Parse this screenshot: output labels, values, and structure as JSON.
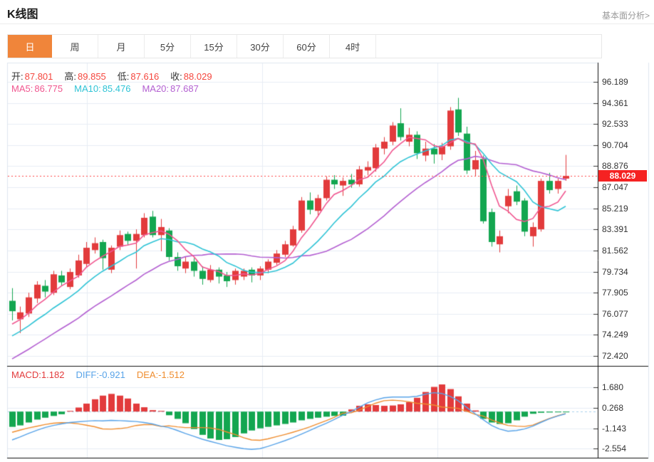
{
  "header": {
    "title": "K线图",
    "link": "基本面分析>"
  },
  "tabs": {
    "items": [
      "日",
      "周",
      "月",
      "5分",
      "15分",
      "30分",
      "60分",
      "4时"
    ],
    "active_index": 0
  },
  "ohlc": {
    "o_label": "开:",
    "o": "87.801",
    "h_label": "高:",
    "h": "89.855",
    "l_label": "低:",
    "l": "87.616",
    "c_label": "收:",
    "c": "88.029"
  },
  "ma": {
    "ma5_label": "MA5:",
    "ma5": "86.775",
    "ma10_label": "MA10:",
    "ma10": "85.476",
    "ma20_label": "MA20:",
    "ma20": "87.687"
  },
  "macd_info": {
    "macd_label": "MACD:",
    "macd": "1.182",
    "diff_label": "DIFF:",
    "diff": "-0.921",
    "dea_label": "DEA:",
    "dea": "-1.512"
  },
  "price_badge": "88.029",
  "colors": {
    "up": "#e23b3c",
    "down": "#13a650",
    "badge": "#f52222",
    "tab_active": "#f0853a",
    "value_red": "#f5463d",
    "ma5": "#f0558f",
    "ma10": "#2ec3d5",
    "ma20": "#b35fd1",
    "diff_line": "#58a3e8",
    "dea_line": "#ef8d2f",
    "grid": "#e7edf4",
    "zero_dash": "#a9d2ec",
    "price_dotted": "#ff4545",
    "axis_line": "#333333"
  },
  "chart_data": {
    "type": "candlestick",
    "title": "K线图",
    "legend": [
      "MA5",
      "MA10",
      "MA20"
    ],
    "price_axis_ticks": [
      "96.189",
      "94.361",
      "92.533",
      "90.704",
      "88.876",
      "87.047",
      "85.219",
      "83.391",
      "81.562",
      "79.734",
      "77.905",
      "76.077",
      "74.249",
      "72.420"
    ],
    "current_price": 88.029,
    "candles": {
      "open": [
        77.2,
        75.6,
        76.1,
        77.4,
        78.5,
        77.9,
        79.4,
        78.4,
        79.4,
        80.4,
        81.6,
        82.3,
        79.9,
        81.9,
        83.0,
        82.4,
        82.9,
        84.5,
        82.9,
        83.3,
        81.0,
        80.0,
        80.6,
        79.8,
        79.0,
        79.9,
        79.4,
        79.0,
        79.3,
        79.9,
        79.4,
        79.9,
        80.5,
        81.2,
        82.0,
        83.3,
        85.9,
        85.0,
        86.1,
        87.7,
        87.2,
        87.7,
        87.3,
        88.5,
        88.7,
        90.4,
        91.0,
        92.6,
        91.0,
        91.6,
        89.8,
        90.4,
        89.9,
        90.6,
        93.8,
        91.7,
        88.6,
        89.5,
        84.9,
        82.1,
        85.4,
        86.7,
        85.9,
        82.8,
        83.4,
        87.6,
        86.9,
        87.801
      ],
      "high": [
        78.3,
        76.7,
        77.9,
        78.9,
        79.0,
        79.8,
        79.8,
        80.0,
        81.2,
        82.3,
        82.7,
        82.5,
        82.0,
        83.3,
        83.2,
        83.4,
        84.8,
        85.0,
        84.3,
        83.5,
        81.4,
        81.0,
        80.9,
        80.2,
        80.3,
        80.1,
        79.7,
        80.0,
        80.0,
        80.1,
        80.2,
        80.8,
        81.6,
        82.4,
        83.7,
        86.2,
        86.6,
        86.4,
        88.0,
        88.1,
        87.9,
        88.2,
        88.9,
        89.3,
        90.8,
        91.4,
        92.7,
        93.9,
        92.2,
        91.9,
        91.0,
        90.8,
        90.9,
        94.0,
        94.8,
        92.3,
        90.2,
        89.8,
        85.2,
        83.3,
        86.9,
        87.2,
        86.1,
        84.0,
        87.8,
        88.3,
        87.8,
        89.855
      ],
      "low": [
        75.5,
        74.4,
        75.8,
        77.0,
        77.5,
        77.7,
        78.5,
        78.2,
        79.2,
        80.1,
        81.3,
        79.9,
        79.6,
        81.6,
        82.0,
        80.0,
        82.7,
        82.7,
        81.5,
        80.7,
        79.8,
        79.6,
        79.3,
        78.6,
        78.8,
        78.7,
        78.4,
        78.6,
        79.0,
        78.8,
        79.0,
        79.6,
        80.3,
        81.0,
        81.9,
        83.1,
        84.7,
        84.5,
        85.9,
        86.9,
        86.3,
        87.0,
        87.1,
        88.1,
        88.4,
        89.9,
        90.7,
        91.1,
        90.6,
        89.5,
        89.3,
        89.1,
        89.4,
        90.3,
        91.5,
        88.2,
        88.0,
        83.9,
        81.9,
        81.4,
        84.8,
        85.5,
        82.8,
        81.9,
        83.2,
        86.5,
        86.5,
        87.616
      ],
      "close": [
        76.3,
        76.2,
        77.5,
        78.6,
        78.0,
        79.5,
        78.8,
        79.7,
        80.7,
        81.8,
        82.2,
        80.9,
        81.8,
        82.9,
        82.4,
        83.0,
        84.4,
        82.9,
        83.6,
        81.0,
        80.2,
        80.6,
        79.8,
        79.1,
        79.9,
        79.3,
        78.9,
        79.8,
        79.8,
        79.4,
        80.0,
        80.6,
        81.3,
        82.1,
        83.4,
        85.9,
        85.1,
        86.1,
        87.7,
        87.3,
        87.6,
        87.3,
        88.6,
        88.8,
        90.5,
        91.0,
        92.4,
        91.4,
        91.6,
        90.0,
        90.4,
        89.9,
        90.6,
        93.7,
        91.8,
        88.5,
        89.4,
        84.1,
        82.3,
        82.8,
        86.3,
        85.8,
        83.2,
        83.6,
        87.6,
        86.8,
        87.6,
        88.029
      ]
    },
    "macd": {
      "axis_ticks": [
        "1.680",
        "0.268",
        "-1.143",
        "-2.554"
      ],
      "hist": [
        -1.05,
        -0.95,
        -0.75,
        -0.55,
        -0.42,
        -0.3,
        -0.18,
        0.05,
        0.28,
        0.55,
        0.85,
        1.1,
        1.22,
        1.1,
        0.9,
        0.55,
        0.3,
        0.1,
        0.05,
        -0.25,
        -0.5,
        -0.8,
        -1.2,
        -1.6,
        -1.85,
        -1.95,
        -1.9,
        -1.75,
        -1.5,
        -1.3,
        -1.15,
        -1.05,
        -0.95,
        -0.85,
        -0.75,
        -0.6,
        -0.5,
        -0.42,
        -0.35,
        -0.3,
        -0.28,
        0.15,
        0.4,
        0.5,
        0.45,
        0.4,
        0.42,
        0.5,
        0.65,
        0.95,
        1.35,
        1.7,
        1.87,
        1.55,
        1.05,
        0.55,
        0.08,
        -0.5,
        -0.75,
        -0.85,
        -0.8,
        -0.6,
        -0.35,
        -0.15,
        -0.08,
        -0.06,
        -0.05,
        -0.04
      ],
      "diff": [
        -1.95,
        -1.75,
        -1.5,
        -1.28,
        -1.1,
        -0.95,
        -0.85,
        -0.75,
        -0.7,
        -0.66,
        -0.62,
        -0.64,
        -0.6,
        -0.62,
        -0.65,
        -0.68,
        -0.75,
        -0.85,
        -1.0,
        -1.1,
        -1.3,
        -1.5,
        -1.7,
        -1.9,
        -2.05,
        -2.2,
        -2.35,
        -2.45,
        -2.55,
        -2.6,
        -2.55,
        -2.4,
        -2.2,
        -2.0,
        -1.8,
        -1.55,
        -1.3,
        -1.05,
        -0.8,
        -0.55,
        -0.25,
        0.0,
        0.3,
        0.6,
        0.8,
        0.95,
        1.0,
        1.0,
        1.0,
        1.05,
        1.2,
        1.3,
        1.25,
        1.05,
        0.75,
        0.3,
        -0.15,
        -0.55,
        -0.95,
        -1.2,
        -1.35,
        -1.3,
        -1.2,
        -1.0,
        -0.75,
        -0.5,
        -0.3,
        -0.15
      ]
    }
  }
}
